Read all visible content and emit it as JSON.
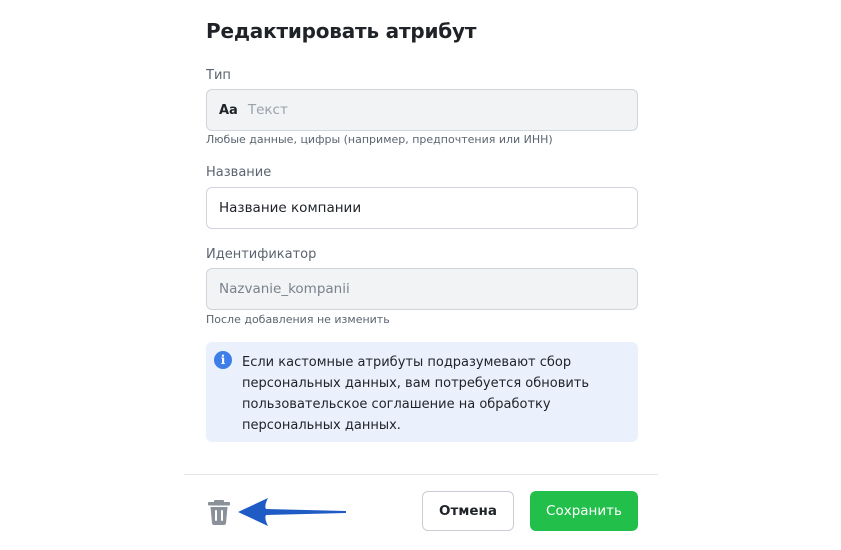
{
  "dialog": {
    "title": "Редактировать атрибут",
    "type": {
      "label": "Тип",
      "glyph": "Aa",
      "value": "Текст",
      "hint": "Любые данные, цифры (например, предпочтения или ИНН)"
    },
    "name": {
      "label": "Название",
      "value": "Название компании"
    },
    "identifier": {
      "label": "Идентификатор",
      "value": "Nazvanie_kompanii",
      "hint": "После добавления не изменить"
    },
    "info": {
      "icon": "info-icon",
      "text": "Если кастомные атрибуты подразумевают сбор персональных данных, вам потребуется обновить пользовательское соглашение на обработку персональных данных."
    },
    "footer": {
      "delete_icon": "trash-icon",
      "cancel_label": "Отмена",
      "save_label": "Сохранить"
    }
  },
  "colors": {
    "accent_green": "#22bf4b",
    "info_bg": "#eaf1fd",
    "info_icon": "#3e7ee8",
    "annotation_arrow": "#1f5bc4"
  }
}
